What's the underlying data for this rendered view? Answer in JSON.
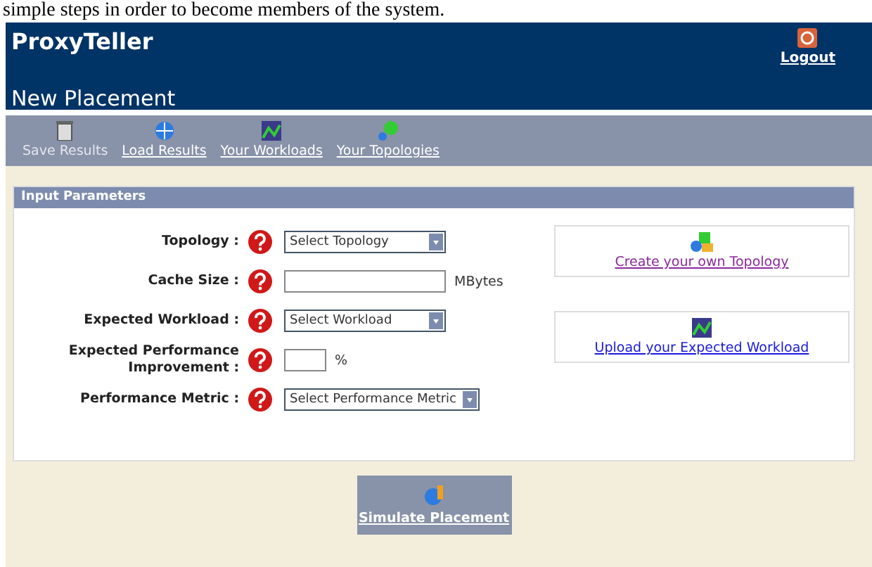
{
  "document_text": "simple steps in order to become members of the system.",
  "header": {
    "app_name": "ProxyTeller",
    "logout": "Logout",
    "page_title": "New Placement"
  },
  "toolbar": [
    {
      "label": "Save Results",
      "kind": "save",
      "disabled": true
    },
    {
      "label": "Load Results",
      "kind": "load",
      "disabled": false
    },
    {
      "label": "Your Workloads",
      "kind": "workloads",
      "disabled": false
    },
    {
      "label": "Your Topologies",
      "kind": "topologies",
      "disabled": false
    }
  ],
  "panel": {
    "title": "Input Parameters",
    "fields": [
      {
        "label": "Topology :",
        "kind": "select",
        "value": "Select Topology"
      },
      {
        "label": "Cache Size :",
        "kind": "text",
        "unit": "MBytes"
      },
      {
        "label": "Expected Workload :",
        "kind": "select",
        "value": "Select Workload"
      },
      {
        "label": "Expected Performance Improvement :",
        "kind": "number",
        "unit": "%"
      },
      {
        "label": "Performance Metric :",
        "kind": "select",
        "value": "Select Performance Metric"
      }
    ],
    "links": [
      {
        "label": "Create your own Topology",
        "kind": "topology",
        "visited": true
      },
      {
        "label": "Upload your Expected Workload",
        "kind": "workload",
        "visited": false
      }
    ]
  },
  "action_button": "Simulate Placement"
}
